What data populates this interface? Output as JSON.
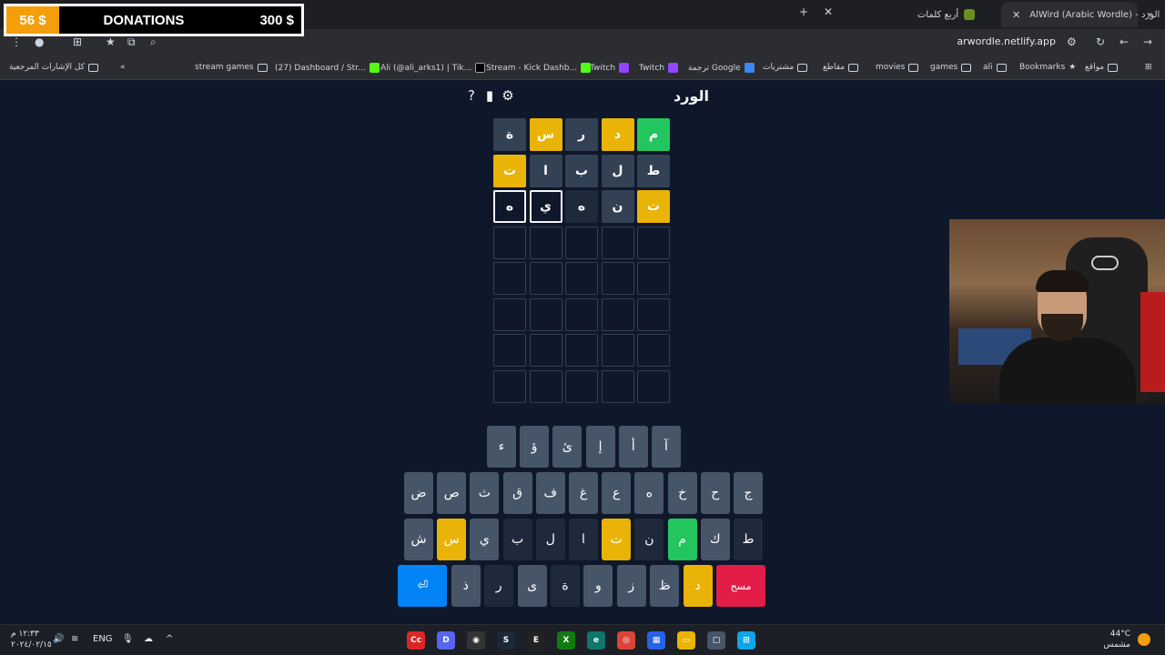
{
  "donations": {
    "current": "56 $",
    "label": "DONATIONS",
    "goal": "300 $"
  },
  "browser": {
    "tabs": [
      {
        "title": "AlWird (Arabic Wordle) - الورد",
        "active": true
      },
      {
        "title": "أربع كلمات",
        "active": false
      }
    ],
    "url": "arwordle.netlify.app",
    "bookmarks": [
      {
        "label": "مواقع",
        "kind": "folder"
      },
      {
        "label": "Bookmarks",
        "kind": "star"
      },
      {
        "label": "ali",
        "kind": "folder"
      },
      {
        "label": "games",
        "kind": "folder"
      },
      {
        "label": "movies",
        "kind": "folder"
      },
      {
        "label": "مقاطع",
        "kind": "folder"
      },
      {
        "label": "مشتريات",
        "kind": "folder"
      },
      {
        "label": "ترجمة Google",
        "kind": "site"
      },
      {
        "label": "Twitch",
        "kind": "site"
      },
      {
        "label": "Twitch",
        "kind": "site"
      },
      {
        "label": "Stream - Kick Dashb...",
        "kind": "site"
      },
      {
        "label": "Ali (@ali_arks1) | Tik...",
        "kind": "site"
      },
      {
        "label": "(27) Dashboard / Str...",
        "kind": "site"
      },
      {
        "label": "stream games",
        "kind": "folder"
      },
      {
        "label": "كل الإشارات المرجعية",
        "kind": "folder"
      }
    ]
  },
  "game": {
    "title": "الورد",
    "board": [
      [
        {
          "l": "م",
          "s": "correct"
        },
        {
          "l": "د",
          "s": "present"
        },
        {
          "l": "ر",
          "s": "absent"
        },
        {
          "l": "س",
          "s": "present"
        },
        {
          "l": "ة",
          "s": "absent"
        }
      ],
      [
        {
          "l": "ط",
          "s": "absent"
        },
        {
          "l": "ل",
          "s": "absent"
        },
        {
          "l": "ب",
          "s": "absent"
        },
        {
          "l": "ا",
          "s": "absent"
        },
        {
          "l": "ت",
          "s": "present"
        }
      ],
      [
        {
          "l": "ت",
          "s": "present"
        },
        {
          "l": "ن",
          "s": "absent"
        },
        {
          "l": "ه",
          "s": "typing-faint"
        },
        {
          "l": "ي",
          "s": "typing"
        },
        {
          "l": "ه",
          "s": "typing"
        }
      ],
      [
        {
          "l": "",
          "s": "empty"
        },
        {
          "l": "",
          "s": "empty"
        },
        {
          "l": "",
          "s": "empty"
        },
        {
          "l": "",
          "s": "empty"
        },
        {
          "l": "",
          "s": "empty"
        }
      ],
      [
        {
          "l": "",
          "s": "empty"
        },
        {
          "l": "",
          "s": "empty"
        },
        {
          "l": "",
          "s": "empty"
        },
        {
          "l": "",
          "s": "empty"
        },
        {
          "l": "",
          "s": "empty"
        }
      ],
      [
        {
          "l": "",
          "s": "empty"
        },
        {
          "l": "",
          "s": "empty"
        },
        {
          "l": "",
          "s": "empty"
        },
        {
          "l": "",
          "s": "empty"
        },
        {
          "l": "",
          "s": "empty"
        }
      ],
      [
        {
          "l": "",
          "s": "empty"
        },
        {
          "l": "",
          "s": "empty"
        },
        {
          "l": "",
          "s": "empty"
        },
        {
          "l": "",
          "s": "empty"
        },
        {
          "l": "",
          "s": "empty"
        }
      ],
      [
        {
          "l": "",
          "s": "empty"
        },
        {
          "l": "",
          "s": "empty"
        },
        {
          "l": "",
          "s": "empty"
        },
        {
          "l": "",
          "s": "empty"
        },
        {
          "l": "",
          "s": "empty"
        }
      ]
    ],
    "keyboard": [
      [
        {
          "k": "آ",
          "s": "unused"
        },
        {
          "k": "أ",
          "s": "unused"
        },
        {
          "k": "إ",
          "s": "unused"
        },
        {
          "k": "ئ",
          "s": "unused"
        },
        {
          "k": "ؤ",
          "s": "unused"
        },
        {
          "k": "ء",
          "s": "unused"
        }
      ],
      [
        {
          "k": "ج",
          "s": "unused"
        },
        {
          "k": "ح",
          "s": "unused"
        },
        {
          "k": "خ",
          "s": "unused"
        },
        {
          "k": "ه",
          "s": "unused"
        },
        {
          "k": "ع",
          "s": "unused"
        },
        {
          "k": "غ",
          "s": "unused"
        },
        {
          "k": "ف",
          "s": "unused"
        },
        {
          "k": "ق",
          "s": "unused"
        },
        {
          "k": "ث",
          "s": "unused"
        },
        {
          "k": "ص",
          "s": "unused"
        },
        {
          "k": "ض",
          "s": "unused"
        }
      ],
      [
        {
          "k": "ط",
          "s": "absent"
        },
        {
          "k": "ك",
          "s": "unused"
        },
        {
          "k": "م",
          "s": "correct"
        },
        {
          "k": "ن",
          "s": "absent"
        },
        {
          "k": "ت",
          "s": "present"
        },
        {
          "k": "ا",
          "s": "absent"
        },
        {
          "k": "ل",
          "s": "absent"
        },
        {
          "k": "ب",
          "s": "absent"
        },
        {
          "k": "ي",
          "s": "unused"
        },
        {
          "k": "س",
          "s": "present"
        },
        {
          "k": "ش",
          "s": "unused"
        }
      ],
      [
        {
          "k": "مسح",
          "s": "delete"
        },
        {
          "k": "د",
          "s": "present"
        },
        {
          "k": "ظ",
          "s": "unused"
        },
        {
          "k": "ز",
          "s": "unused"
        },
        {
          "k": "و",
          "s": "unused"
        },
        {
          "k": "ة",
          "s": "absent"
        },
        {
          "k": "ى",
          "s": "unused"
        },
        {
          "k": "ر",
          "s": "absent"
        },
        {
          "k": "ذ",
          "s": "unused"
        },
        {
          "k": "⏎",
          "s": "enter"
        }
      ]
    ]
  },
  "taskbar": {
    "time": "١٢:٣٣ م",
    "date": "٢٠٢٤/٠٢/١٥",
    "lang": "ENG",
    "weather_temp": "44°C",
    "weather_desc": "مشمس"
  },
  "colors": {
    "correct": "#22c55e",
    "present": "#eab308",
    "absent": "#1e293b",
    "unused": "#475569",
    "enter": "#0284f7",
    "delete": "#e11d48"
  }
}
